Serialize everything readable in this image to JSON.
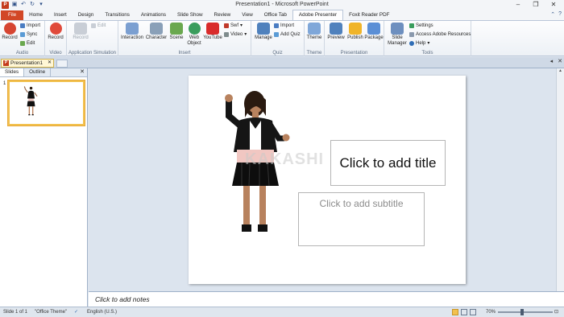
{
  "window": {
    "title": "Presentation1 - Microsoft PowerPoint",
    "controls": [
      "–",
      "❐",
      "✕"
    ]
  },
  "tabs": [
    "File",
    "Home",
    "Insert",
    "Design",
    "Transitions",
    "Animations",
    "Slide Show",
    "Review",
    "View",
    "Office Tab",
    "Adobe Presenter",
    "Foxit Reader PDF"
  ],
  "ribbon": {
    "audio": {
      "label": "Audio",
      "record": "Record",
      "import": "Import",
      "sync": "Sync",
      "edit": "Edit"
    },
    "video": {
      "label": "Video",
      "record": "Record"
    },
    "appsim": {
      "label": "Application Simulation",
      "record": "Record",
      "edit": "Edit"
    },
    "insert": {
      "label": "Insert",
      "interaction": "Interaction",
      "character": "Character",
      "scene": "Scene",
      "web_object": "Web Object",
      "youtube": "YouTube",
      "swf": "Swf",
      "video": "Video"
    },
    "quiz": {
      "label": "Quiz",
      "manage": "Manage",
      "import": "Import",
      "add_quiz": "Add Quiz"
    },
    "theme": {
      "label": "Theme",
      "theme": "Theme"
    },
    "presentation": {
      "label": "Presentation",
      "preview": "Preview",
      "publish": "Publish",
      "package": "Package"
    },
    "tools": {
      "label": "Tools",
      "slide_manager": "Slide Manager",
      "settings": "Settings",
      "access": "Access Adobe Resources",
      "help": "Help"
    }
  },
  "doc_tab": {
    "name": "Presentation1"
  },
  "panel": {
    "tabs": [
      "Slides",
      "Outline"
    ],
    "slide_number": "1"
  },
  "slide": {
    "title_placeholder": "Click to add title",
    "subtitle_placeholder": "Click to add subtitle",
    "watermark": "KAKASHI"
  },
  "notes": {
    "placeholder": "Click to add notes"
  },
  "status": {
    "slide": "Slide 1 of 1",
    "theme": "\"Office Theme\"",
    "language": "English (U.S.)",
    "zoom": "70%"
  },
  "colors": {
    "file_tab": "#d24726",
    "accent": "#2a4c85",
    "selection": "#f2c14e"
  }
}
